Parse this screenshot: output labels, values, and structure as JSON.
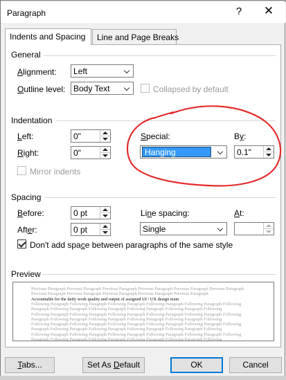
{
  "dialog": {
    "title": "Paragraph",
    "help_glyph": "?",
    "close_glyph": "✕"
  },
  "tabs": [
    {
      "label": "Indents and Spacing",
      "active": true
    },
    {
      "label": "Line and Page Breaks",
      "active": false
    }
  ],
  "general": {
    "heading": "General",
    "alignment": {
      "label_pre": "",
      "label_key": "A",
      "label_post": "lignment:",
      "value": "Left"
    },
    "outline_level": {
      "label_pre": "",
      "label_key": "O",
      "label_post": "utline level:",
      "value": "Body Text"
    },
    "collapsed": {
      "label": "Collapsed by default",
      "checked": false,
      "enabled": false
    }
  },
  "indentation": {
    "heading": "Indentation",
    "left": {
      "label_key": "L",
      "label_post": "eft:",
      "value": "0\""
    },
    "right": {
      "label_key": "R",
      "label_post": "ight:",
      "value": "0\""
    },
    "mirror": {
      "label": "Mirror indents",
      "checked": false,
      "enabled": false
    },
    "special": {
      "label_key": "S",
      "label_post": "pecial:",
      "value": "Hanging"
    },
    "by": {
      "label_pre": "B",
      "label_key": "y",
      "label_post": ":",
      "value": "0.1\""
    }
  },
  "spacing": {
    "heading": "Spacing",
    "before": {
      "label_key": "B",
      "label_post": "efore:",
      "value": "0 pt"
    },
    "after": {
      "label_pre": "Aft",
      "label_key": "e",
      "label_post": "r:",
      "value": "0 pt"
    },
    "line_spacing": {
      "label_pre": "Li",
      "label_key": "n",
      "label_post": "e spacing:",
      "value": "Single"
    },
    "at": {
      "label_key": "A",
      "label_post": "t:",
      "value": ""
    },
    "dont_add": {
      "label_pre": "Don't add spa",
      "label_key": "c",
      "label_post": "e between paragraphs of the same style",
      "checked": true
    }
  },
  "preview": {
    "heading": "Preview",
    "lines": [
      {
        "text": "Previous Paragraph Previous Paragraph Previous Paragraph Previous Paragraph Previous Paragraph Previous Paragraph",
        "dark": false
      },
      {
        "text": "Previous Paragraph Previous Paragraph Previous Paragraph Previous Paragraph Previous Paragraph",
        "dark": false
      },
      {
        "text": "Accountable for the daily work quality and output of assigned UI / UX design team",
        "dark": true
      },
      {
        "text": "Following Paragraph Following Paragraph Following Paragraph Following Paragraph Following Paragraph Following",
        "dark": false
      },
      {
        "text": "Paragraph Following Paragraph Following Paragraph Following Paragraph Following Paragraph Following",
        "dark": false
      },
      {
        "text": "Following Paragraph Following Paragraph Following Paragraph Following Paragraph Following Paragraph Following",
        "dark": false
      },
      {
        "text": "Paragraph Following Paragraph Following Paragraph Following Paragraph Following Paragraph Following",
        "dark": false
      },
      {
        "text": "Following Paragraph Following Paragraph Following Paragraph Following Paragraph Following Paragraph Following",
        "dark": false
      },
      {
        "text": "Paragraph Following Paragraph Following Paragraph Following Paragraph Following Paragraph Following",
        "dark": false
      },
      {
        "text": "Following Paragraph Following Paragraph Following Paragraph Following Paragraph Following Paragraph Following",
        "dark": false
      },
      {
        "text": "Paragraph Following Paragraph Following Paragraph Following Paragraph Following Paragraph Following",
        "dark": false
      }
    ]
  },
  "buttons": {
    "tabs": {
      "label_key": "T",
      "label_post": "abs..."
    },
    "set_default": {
      "label_pre": "Set As ",
      "label_key": "D",
      "label_post": "efault"
    },
    "ok": {
      "label": "OK"
    },
    "cancel": {
      "label": "Cancel"
    }
  },
  "colors": {
    "selection": "#3399ff",
    "annotation": "#e32b2b",
    "default_button_border": "#0078d7"
  },
  "icons": {
    "help": "help-icon",
    "close": "close-icon",
    "dropdown": "chevron-down-icon",
    "spin_up": "spin-up-icon",
    "spin_down": "spin-down-icon",
    "check": "check-icon"
  }
}
